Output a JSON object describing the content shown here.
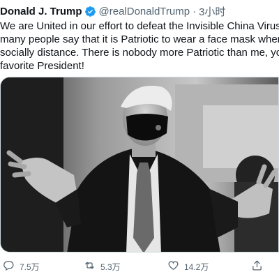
{
  "header": {
    "name": "Donald J. Trump",
    "handle": "@realDonaldTrump",
    "separator": "·",
    "time": "3小时"
  },
  "tweet": {
    "lines": [
      "We are United in our effort to defeat the Invisible China Virus, a",
      "many people say that it is Patriotic to wear a face mask when y",
      "socially distance. There is nobody more Patriotic than me, your",
      "favorite President!"
    ]
  },
  "actions": {
    "reply_count": "7.5万",
    "retweet_count": "5.3万",
    "like_count": "14.2万"
  },
  "icons": {
    "verified": "verified-badge-icon",
    "reply": "reply-icon",
    "retweet": "retweet-icon",
    "like": "heart-icon",
    "share": "share-icon"
  },
  "colors": {
    "verified_blue": "#1d9bf0",
    "muted_text": "#536471"
  }
}
